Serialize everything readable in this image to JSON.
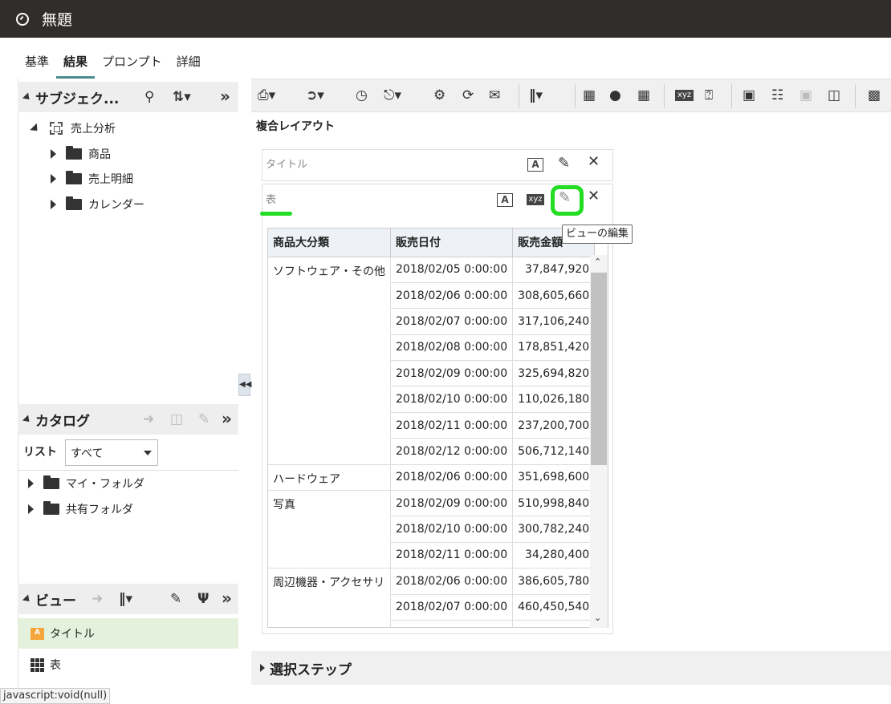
{
  "window": {
    "title": "無題"
  },
  "tabs": [
    "基準",
    "結果",
    "プロンプト",
    "詳細"
  ],
  "active_tab": "結果",
  "subject_panel": {
    "title": "サブジェク...",
    "root": "売上分析",
    "folders": [
      "商品",
      "売上明細",
      "カレンダー"
    ]
  },
  "catalog_panel": {
    "title": "カタログ",
    "list_label": "リスト",
    "list_value": "すべて",
    "folders": [
      "マイ・フォルダ",
      "共有フォルダ"
    ]
  },
  "views_panel": {
    "title": "ビュー",
    "items": [
      "タイトル",
      "表"
    ],
    "selected": "タイトル"
  },
  "status_bar": "javascript:void(null)",
  "layout": {
    "heading": "複合レイアウト",
    "title_view_label": "タイトル",
    "table_view_label": "表",
    "tooltip": "ビューの編集",
    "highlight_color": "#22dd22"
  },
  "table": {
    "headers": [
      "商品大分類",
      "販売日付",
      "販売金額"
    ],
    "rows": [
      {
        "category": "ソフトウェア・その他",
        "span": 8,
        "date": "2018/02/05 0:00:00",
        "amount": "37,847,920"
      },
      {
        "date": "2018/02/06 0:00:00",
        "amount": "308,605,660"
      },
      {
        "date": "2018/02/07 0:00:00",
        "amount": "317,106,240"
      },
      {
        "date": "2018/02/08 0:00:00",
        "amount": "178,851,420"
      },
      {
        "date": "2018/02/09 0:00:00",
        "amount": "325,694,820"
      },
      {
        "date": "2018/02/10 0:00:00",
        "amount": "110,026,180"
      },
      {
        "date": "2018/02/11 0:00:00",
        "amount": "237,200,700"
      },
      {
        "date": "2018/02/12 0:00:00",
        "amount": "506,712,140"
      },
      {
        "category": "ハードウェア",
        "span": 1,
        "date": "2018/02/06 0:00:00",
        "amount": "351,698,600"
      },
      {
        "category": "写真",
        "span": 3,
        "date": "2018/02/09 0:00:00",
        "amount": "510,998,840"
      },
      {
        "date": "2018/02/10 0:00:00",
        "amount": "300,782,240"
      },
      {
        "date": "2018/02/11 0:00:00",
        "amount": "34,280,400"
      },
      {
        "category": "周辺機器・アクセサリ",
        "span": 3,
        "date": "2018/02/06 0:00:00",
        "amount": "386,605,780"
      },
      {
        "date": "2018/02/07 0:00:00",
        "amount": "460,450,540"
      },
      {
        "date": "",
        "amount": ""
      }
    ]
  },
  "selection_steps": {
    "title": "選択ステップ"
  },
  "icons": {
    "print": "print-icon",
    "export": "export-icon",
    "schedule": "schedule-icon",
    "refresh": "refresh-icon",
    "email": "email-icon",
    "new_view": "new-view-icon"
  }
}
